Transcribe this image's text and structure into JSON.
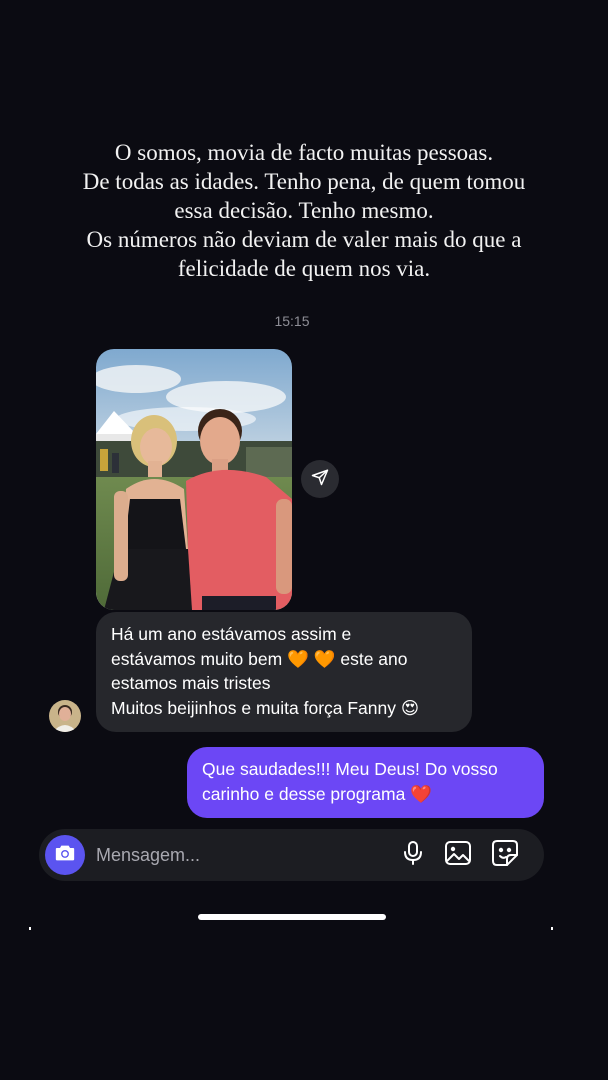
{
  "story_caption": {
    "lines": [
      "O somos, movia de facto muitas pessoas.",
      "De todas as idades. Tenho pena, de quem tomou",
      "essa decisão. Tenho mesmo.",
      "Os números não deviam de valer mais do que a",
      "felicidade de quem nos via."
    ]
  },
  "conversation": {
    "timestamp": "15:15",
    "incoming": {
      "lines": [
        "Há um ano estávamos assim e",
        "estávamos muito bem 🧡 🧡 este ano",
        "estamos mais tristes",
        "Muitos beijinhos e muita força Fanny 😍"
      ]
    },
    "outgoing": {
      "lines": [
        "Que saudades!!! Meu Deus! Do vosso",
        "carinho e desse programa ❤️"
      ]
    }
  },
  "composer": {
    "placeholder": "Mensagem...",
    "icons": [
      "camera-icon",
      "microphone-icon",
      "gallery-icon",
      "sticker-icon"
    ]
  },
  "icons": {
    "share": "send-icon"
  },
  "colors": {
    "background": "#0b0b12",
    "incoming_bubble": "#26272c",
    "outgoing_bubble": "#6c47f5",
    "camera_button": "#5b54f0",
    "timestamp": "#8e8e96"
  }
}
